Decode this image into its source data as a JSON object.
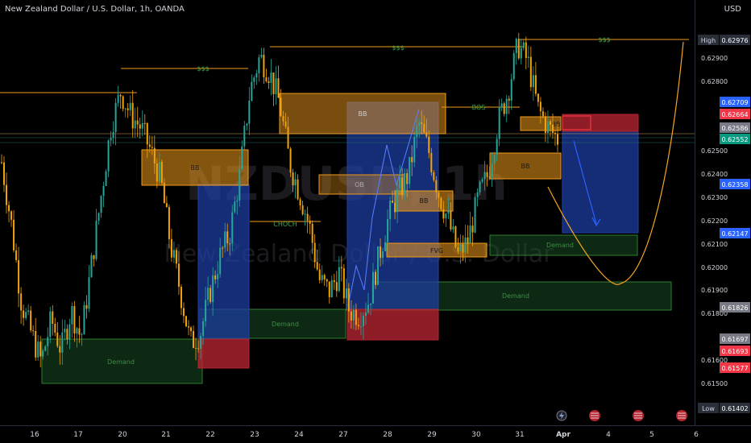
{
  "header": {
    "symbol_title": "New Zealand Dollar / U.S. Dollar, 1h, OANDA",
    "currency": "USD"
  },
  "watermark": {
    "ticker": "NZDUSD, 1h",
    "name": "New Zealand Dollar / U.S. Dollar"
  },
  "colors": {
    "background": "#000000",
    "up": "#26a69a",
    "down": "#f0a30a",
    "bb_zone": "#f09a1a",
    "demand_zone": "#1e5c2a",
    "short_target": "#1e3fa8",
    "short_stop": "#b22432",
    "axis_text": "#d1d4dc"
  },
  "chart_data": {
    "type": "candlestick",
    "timeframe": "1h",
    "ylim": [
      0.614,
      0.63
    ],
    "x_ticks": [
      "16",
      "17",
      "20",
      "21",
      "22",
      "23",
      "24",
      "27",
      "28",
      "29",
      "30",
      "31",
      "Apr",
      "4",
      "5",
      "6"
    ],
    "y_ticks": [
      "0.62900",
      "0.62800",
      "0.62500",
      "0.62400",
      "0.62300",
      "0.62200",
      "0.62100",
      "0.62000",
      "0.61900",
      "0.61800",
      "0.61600",
      "0.61500"
    ],
    "grid": false,
    "price_labels": [
      {
        "label": "High",
        "value": "0.62976",
        "color": "#2a2e39"
      },
      {
        "label": "",
        "value": "0.62709",
        "color": "#2962ff"
      },
      {
        "label": "",
        "value": "0.62664",
        "color": "#f23645"
      },
      {
        "label": "",
        "value": "0.62586",
        "color": "#787b86"
      },
      {
        "label": "",
        "value": "0.62552",
        "color": "#089981"
      },
      {
        "label": "",
        "value": "0.62358",
        "color": "#2962ff"
      },
      {
        "label": "",
        "value": "0.62147",
        "color": "#2962ff"
      },
      {
        "label": "",
        "value": "0.61826",
        "color": "#787b86"
      },
      {
        "label": "",
        "value": "0.61697",
        "color": "#787b86"
      },
      {
        "label": "",
        "value": "0.61693",
        "color": "#f23645"
      },
      {
        "label": "",
        "value": "0.61577",
        "color": "#f23645"
      },
      {
        "label": "Low",
        "value": "0.61402",
        "color": "#2a2e39"
      }
    ],
    "zone_labels": {
      "bb": "BB",
      "ob": "OB",
      "fvg": "FVG",
      "demand": "Demand",
      "liquidity": "$$$",
      "choch": "CHOCH",
      "bos": "BOS"
    },
    "close_path": [
      0.6245,
      0.6218,
      0.6185,
      0.6172,
      0.616,
      0.6178,
      0.6165,
      0.6182,
      0.617,
      0.62,
      0.623,
      0.626,
      0.6275,
      0.6265,
      0.626,
      0.625,
      0.6238,
      0.621,
      0.619,
      0.6168,
      0.6172,
      0.619,
      0.6205,
      0.6215,
      0.624,
      0.6275,
      0.629,
      0.6283,
      0.627,
      0.6245,
      0.6232,
      0.6218,
      0.6195,
      0.619,
      0.6198,
      0.6182,
      0.618,
      0.6186,
      0.6205,
      0.6222,
      0.6232,
      0.624,
      0.6262,
      0.625,
      0.6232,
      0.622,
      0.6205,
      0.6212,
      0.623,
      0.624,
      0.6262,
      0.6275,
      0.6295,
      0.6288,
      0.6268,
      0.626,
      0.6255
    ]
  }
}
